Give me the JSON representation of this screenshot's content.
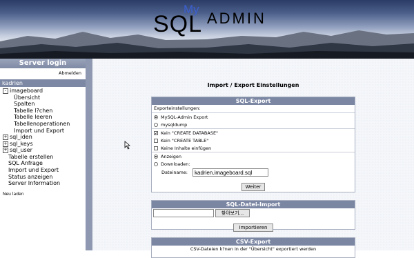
{
  "logo": {
    "my": "My",
    "sql": "SQL",
    "admin": "ADMIN"
  },
  "sidebar": {
    "title": "Server login",
    "logout": "Abmelden",
    "user": "kadrien",
    "db_current": "imageboard",
    "db_items": [
      "Übersicht",
      "Spalten",
      "Tabelle l?chen",
      "Tabelle leeren",
      "Tabellenoperationen",
      "Import und Export"
    ],
    "other_dbs": [
      "sql_iden",
      "sql_keys",
      "sql_user"
    ],
    "actions": [
      "Tabelle erstellen",
      "SQL Anfrage",
      "Import und Export",
      "Status anzeigen",
      "Server Information"
    ],
    "reload": "Neu laden"
  },
  "main": {
    "title": "Import / Export Einstellungen",
    "sql_export": {
      "header": "SQL-Export",
      "settings_label": "Exporteinstellungen:",
      "formats": [
        {
          "label": "MySQL-Admin Export",
          "selected": true
        },
        {
          "label": "mysqldump",
          "selected": false
        }
      ],
      "checkboxes": [
        {
          "label": "Kein \"CREATE DATABASE\"",
          "checked": true
        },
        {
          "label": "Kein \"CREATE TABLE\"",
          "checked": false
        },
        {
          "label": "Keine Inhalte einfügen",
          "checked": false
        }
      ],
      "output": [
        {
          "label": "Anzeigen",
          "selected": true
        },
        {
          "label": "Downloaden:",
          "selected": false
        }
      ],
      "filename_label": "Dateiname:",
      "filename_value": "kadrien.imageboard.sql",
      "submit": "Weiter"
    },
    "sql_import": {
      "header": "SQL-Datei-Import",
      "browse": "찾아보기...",
      "submit": "Importieren"
    },
    "csv_export": {
      "header": "CSV-Export",
      "note": "CSV-Dateien k?nen in der \"Übersicht\" exportiert werden"
    }
  }
}
